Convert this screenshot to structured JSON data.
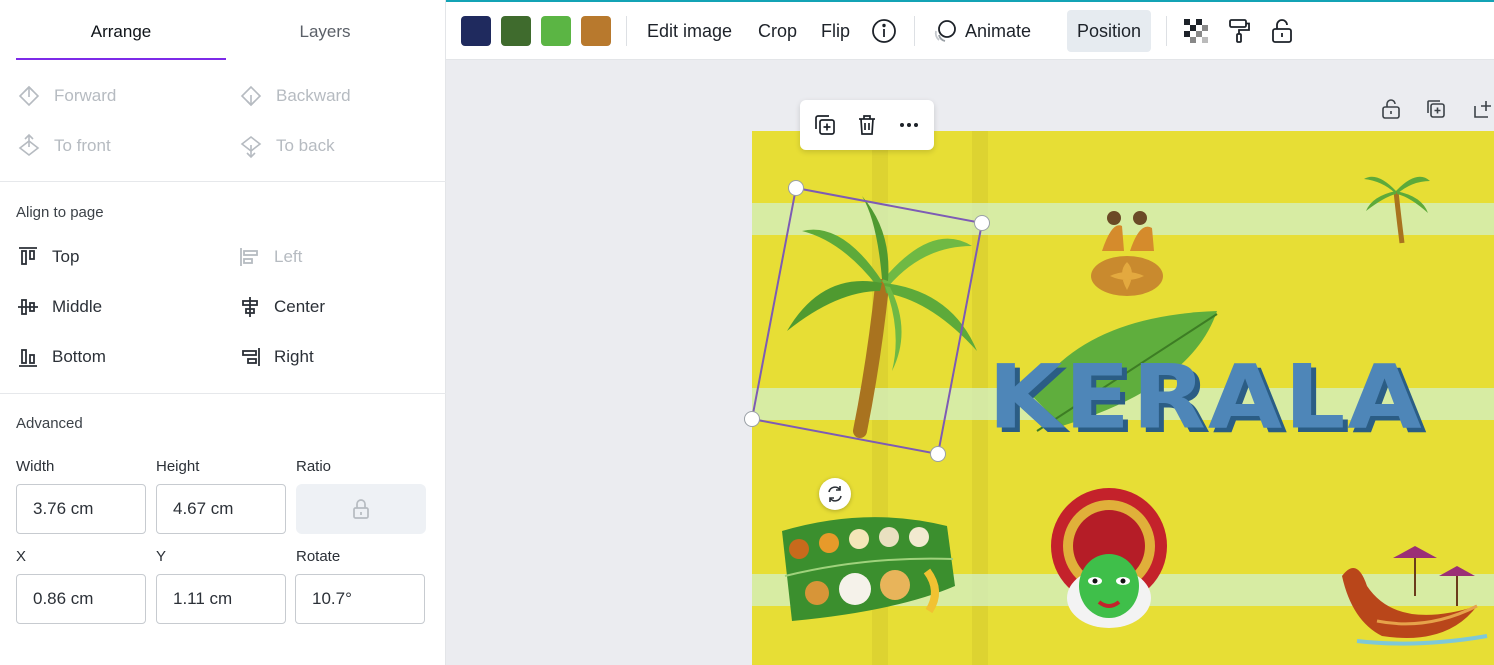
{
  "panel": {
    "tabs": [
      {
        "label": "Arrange"
      },
      {
        "label": "Layers"
      }
    ],
    "arrange": {
      "forward": "Forward",
      "backward": "Backward",
      "to_front": "To front",
      "to_back": "To back"
    },
    "align": {
      "title": "Align to page",
      "top": "Top",
      "left": "Left",
      "middle": "Middle",
      "center": "Center",
      "bottom": "Bottom",
      "right": "Right"
    },
    "advanced": {
      "title": "Advanced",
      "width_label": "Width",
      "width_value": "3.76 cm",
      "height_label": "Height",
      "height_value": "4.67 cm",
      "ratio_label": "Ratio",
      "x_label": "X",
      "x_value": "0.86 cm",
      "y_label": "Y",
      "y_value": "1.11 cm",
      "rotate_label": "Rotate",
      "rotate_value": "10.7°"
    }
  },
  "toolbar": {
    "swatches": [
      "#1f2a5e",
      "#3f6b2d",
      "#5bb544",
      "#b8792d"
    ],
    "edit_image": "Edit image",
    "crop": "Crop",
    "flip": "Flip",
    "animate": "Animate",
    "position": "Position",
    "icons": [
      "info-icon",
      "animate-icon",
      "transparency-icon",
      "paint-roller-icon",
      "lock-icon"
    ]
  },
  "canvas": {
    "title_text": "KERALA",
    "background": "#e7de35",
    "selection_color": "#7d5bb5"
  }
}
